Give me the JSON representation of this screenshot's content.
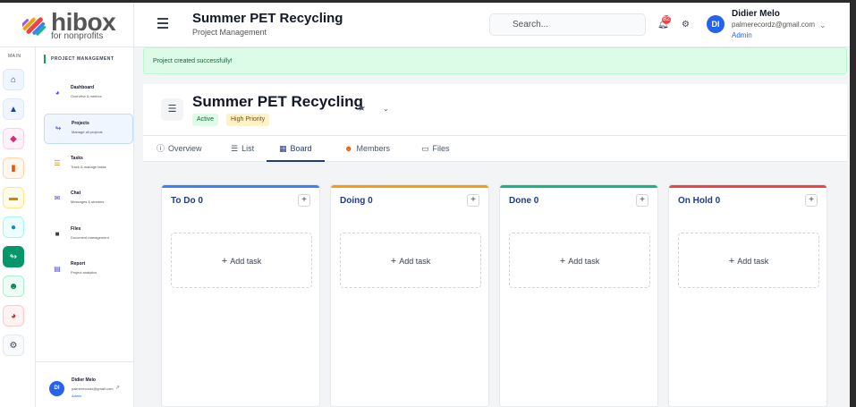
{
  "brand": {
    "name": "hibox",
    "tagline": "for nonprofits"
  },
  "header": {
    "title": "Summer PET Recycling",
    "subtitle": "Project Management",
    "search_placeholder": "Search...",
    "notification_count": "82",
    "user": {
      "initials": "DI",
      "name": "Didier Melo",
      "email": "palmerecordz@gmail.com",
      "role": "Admin"
    }
  },
  "rail": {
    "label": "MAIN",
    "icons": [
      "home-icon",
      "sitemap-icon",
      "tag-icon",
      "book-icon",
      "graduation-icon",
      "circle-icon",
      "project-icon",
      "people-icon",
      "pie-chart-icon",
      "gear-icon"
    ]
  },
  "sidenav": {
    "section_title": "PROJECT MANAGEMENT",
    "items": [
      {
        "title": "Dashboard",
        "desc": "Overview & metrics",
        "icon": "gauge-icon"
      },
      {
        "title": "Projects",
        "desc": "Manage all projects",
        "icon": "project-diagram-icon"
      },
      {
        "title": "Tasks",
        "desc": "Track & manage tasks",
        "icon": "tasks-icon"
      },
      {
        "title": "Chat",
        "desc": "Messages & streams",
        "icon": "chat-icon"
      },
      {
        "title": "Files",
        "desc": "Document management",
        "icon": "folder-icon"
      },
      {
        "title": "Report",
        "desc": "Project analytics",
        "icon": "chart-icon"
      }
    ],
    "footer": {
      "initials": "DI",
      "name": "Didier Melo",
      "email": "palmerecordz@gmail.com",
      "role": "Admin"
    }
  },
  "alert": {
    "text": "Project created successfully!"
  },
  "project": {
    "title": "Summer PET Recycling",
    "status": "Active",
    "priority": "High Priority"
  },
  "tabs": [
    {
      "label": "Overview",
      "icon": "info-icon"
    },
    {
      "label": "List",
      "icon": "list-icon"
    },
    {
      "label": "Board",
      "icon": "board-icon",
      "active": true
    },
    {
      "label": "Members",
      "icon": "users-icon"
    },
    {
      "label": "Files",
      "icon": "folder-open-icon"
    }
  ],
  "board": {
    "add_task_label": "Add task",
    "columns": [
      {
        "title": "To Do 0",
        "color": "#3b82f6"
      },
      {
        "title": "Doing 0",
        "color": "#f59e0b"
      },
      {
        "title": "Done 0",
        "color": "#10b981"
      },
      {
        "title": "On Hold 0",
        "color": "#ef4444"
      }
    ]
  },
  "colors": {
    "accent": "#1e3a8a",
    "brand_blue": "#2563eb",
    "success_bg": "#dcfce7"
  }
}
